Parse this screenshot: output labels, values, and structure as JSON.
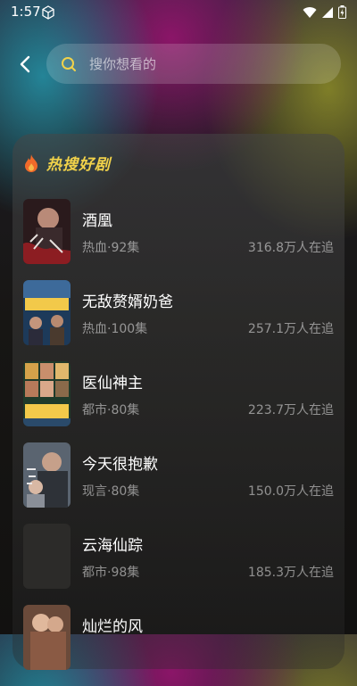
{
  "status_bar": {
    "time": "1:57"
  },
  "search": {
    "placeholder": "搜你想看的"
  },
  "panel": {
    "title": "热搜好剧",
    "items": [
      {
        "title": "酒凰",
        "meta": "热血·92集",
        "followers": "316.8万人在追",
        "poster": "poster-jiuhuang"
      },
      {
        "title": "无敌赘婿奶爸",
        "meta": "热血·100集",
        "followers": "257.1万人在追",
        "poster": "poster-wudi"
      },
      {
        "title": "医仙神主",
        "meta": "都市·80集",
        "followers": "223.7万人在追",
        "poster": "poster-yixian"
      },
      {
        "title": "今天很抱歉",
        "meta": "现言·80集",
        "followers": "150.0万人在追",
        "poster": "poster-jintian"
      },
      {
        "title": "云海仙踪",
        "meta": "都市·98集",
        "followers": "185.3万人在追",
        "poster": "poster-placeholder"
      },
      {
        "title": "灿烂的风",
        "meta": "",
        "followers": "",
        "poster": "poster-canlan"
      }
    ]
  },
  "colors": {
    "accent": "#f1d24a",
    "search_icon": "#f1d24a",
    "flame": "#f06a2a"
  }
}
